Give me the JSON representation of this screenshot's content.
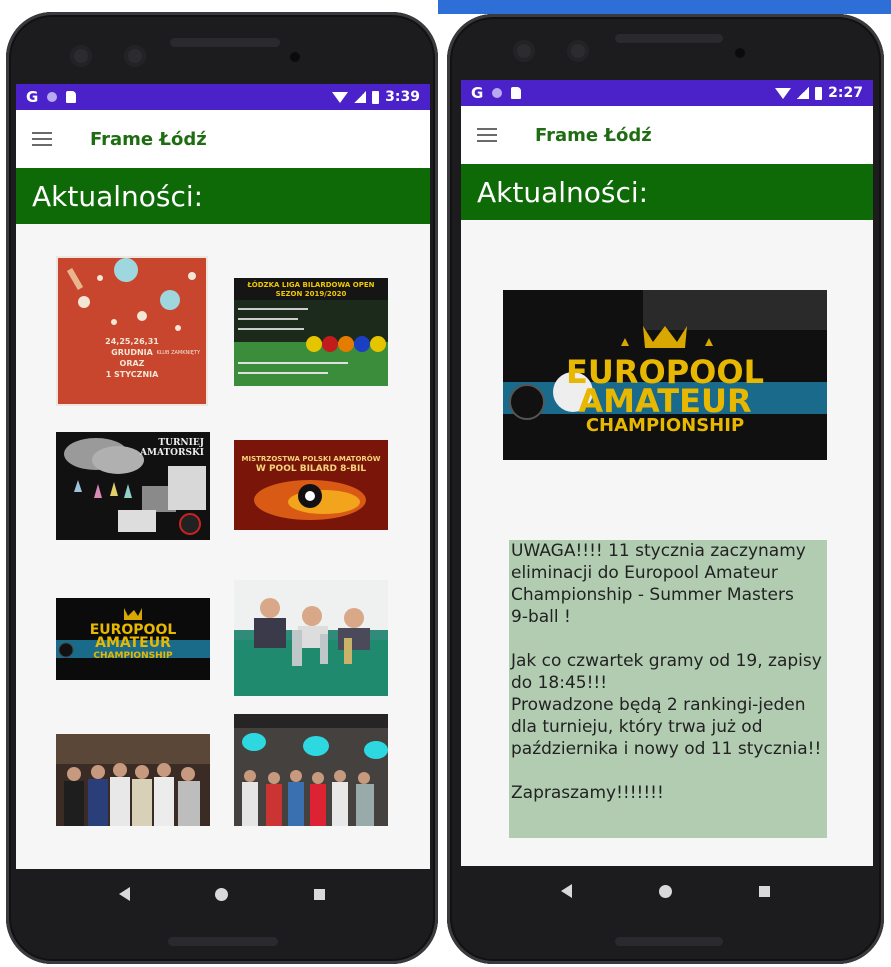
{
  "app": {
    "title": "Frame Łódź",
    "section_heading": "Aktualności:"
  },
  "left_phone": {
    "status_time": "3:39",
    "status_g": "G",
    "thumbnails": [
      {
        "name": "christmas-schedule-poster",
        "lines": [
          "24,25,26,31",
          "GRUDNIA",
          "ORAZ",
          "1 STYCZNIA",
          "KLUB ZAMKNIĘTY"
        ]
      },
      {
        "name": "lodzka-liga-poster",
        "lines": [
          "ŁÓDZKA LIGA BILARDOWA OPEN",
          "SEZON 2019/2020"
        ]
      },
      {
        "name": "turniej-amatorski-poster",
        "lines": [
          "TURNIEJ",
          "AMATORSKI"
        ]
      },
      {
        "name": "mistrzostwa-polski-poster",
        "lines": [
          "MISTRZOSTWA POLSKI AMATORÓW",
          "W POOL BILARD 8-BIL"
        ]
      },
      {
        "name": "europool-poster",
        "lines": [
          "EUROPOOL",
          "AMATEUR",
          "CHAMPIONSHIP"
        ]
      },
      {
        "name": "winners-trophies-photo",
        "lines": []
      },
      {
        "name": "group-photo-1",
        "lines": []
      },
      {
        "name": "group-photo-2",
        "lines": []
      }
    ]
  },
  "right_phone": {
    "status_time": "2:27",
    "status_g": "G",
    "hero": {
      "lines": [
        "EUROPOOL",
        "AMATEUR",
        "CHAMPIONSHIP"
      ]
    },
    "news_paragraphs": [
      "UWAGA!!!! 11 stycznia zaczynamy\neliminacji do Europool Amateur\nChampionship - Summer Masters\n9-ball !",
      "Jak co czwartek gramy od 19, zapisy\ndo 18:45!!!\nProwadzone będą 2 rankingi-jeden\ndla turnieju, który trwa już od\npaździernika i nowy od 11 stycznia!!",
      "Zapraszamy!!!!!!!"
    ]
  },
  "colors": {
    "status_bar": "#4b22c9",
    "title_green": "#1f6d12",
    "banner_green": "#0e6a06",
    "news_bg": "#b2ccb2"
  }
}
